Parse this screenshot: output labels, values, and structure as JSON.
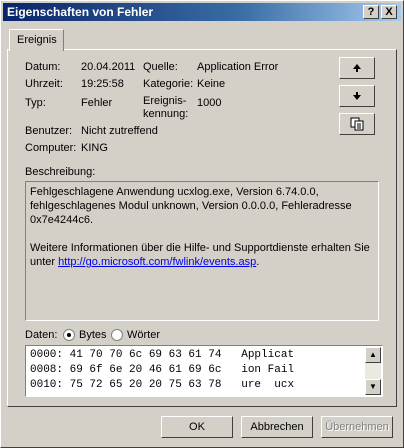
{
  "window": {
    "title": "Eigenschaften von Fehler"
  },
  "titlebar_buttons": {
    "help": "?",
    "close": "X"
  },
  "tabs": [
    {
      "label": "Ereignis"
    }
  ],
  "details": {
    "date_label": "Datum:",
    "date_value": "20.04.2011",
    "time_label": "Uhrzeit:",
    "time_value": "19:25:58",
    "type_label": "Typ:",
    "type_value": "Fehler",
    "user_label": "Benutzer:",
    "user_value": "Nicht zutreffend",
    "computer_label": "Computer:",
    "computer_value": "KING",
    "source_label": "Quelle:",
    "source_value": "Application Error",
    "category_label": "Kategorie:",
    "category_value": "Keine",
    "event_id_label_1": "Ereignis-",
    "event_id_label_2": "kennung:",
    "event_id_value": "1000"
  },
  "nav_buttons": {
    "up_icon": "arrow-up-icon",
    "down_icon": "arrow-down-icon",
    "copy_icon": "copy-icon"
  },
  "description": {
    "label": "Beschreibung:",
    "line1": "Fehlgeschlagene Anwendung ucxlog.exe, Version 6.74.0.0,",
    "line2": "fehlgeschlagenes Modul unknown, Version 0.0.0.0, Fehleradresse",
    "line3": "0x7e4244c6.",
    "line4": "Weitere Informationen über die Hilfe- und Supportdienste erhalten Sie",
    "line5_prefix": "unter ",
    "link": "http://go.microsoft.com/fwlink/events.asp",
    "line5_suffix": "."
  },
  "data_section": {
    "label": "Daten:",
    "radio_bytes": "Bytes",
    "radio_words": "Wörter",
    "selected": "Bytes",
    "lines": [
      "0000: 41 70 70 6c 69 63 61 74   Applicat",
      "0008: 69 6f 6e 20 46 61 69 6c   ion Fail",
      "0010: 75 72 65 20 20 75 63 78   ure  ucx"
    ]
  },
  "buttons": {
    "ok": "OK",
    "cancel": "Abbrechen",
    "apply": "Übernehmen"
  }
}
